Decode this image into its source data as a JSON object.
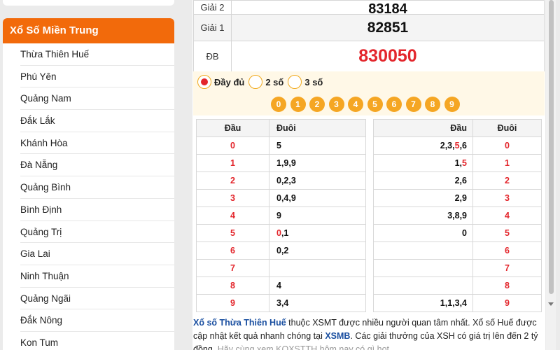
{
  "sidebar": {
    "title": "Xổ Số Miền Trung",
    "items": [
      {
        "label": "Thừa Thiên Huế"
      },
      {
        "label": "Phú Yên"
      },
      {
        "label": "Quảng Nam"
      },
      {
        "label": "Đắk Lắk"
      },
      {
        "label": "Khánh Hòa"
      },
      {
        "label": "Đà Nẵng"
      },
      {
        "label": "Quảng Bình"
      },
      {
        "label": "Bình Định"
      },
      {
        "label": "Quảng Trị"
      },
      {
        "label": "Gia Lai"
      },
      {
        "label": "Ninh Thuận"
      },
      {
        "label": "Quảng Ngãi"
      },
      {
        "label": "Đắk Nông"
      },
      {
        "label": "Kon Tum"
      }
    ]
  },
  "results": {
    "g2": {
      "label": "Giải 2",
      "value": "83184"
    },
    "g1": {
      "label": "Giải 1",
      "value": "82851"
    },
    "db": {
      "label": "ĐB",
      "value": "830050"
    }
  },
  "filters": {
    "options": [
      {
        "label": "Đầy đủ",
        "selected": true
      },
      {
        "label": "2 số",
        "selected": false
      },
      {
        "label": "3 số",
        "selected": false
      }
    ],
    "digits": [
      "0",
      "1",
      "2",
      "3",
      "4",
      "5",
      "6",
      "7",
      "8",
      "9"
    ]
  },
  "loto_left": {
    "header_dau": "Đầu",
    "header_duoi": "Đuôi",
    "rows": [
      {
        "dau": "0",
        "duoi": "5"
      },
      {
        "dau": "1",
        "duoi": "1,9,9"
      },
      {
        "dau": "2",
        "duoi": "0,2,3"
      },
      {
        "dau": "3",
        "duoi": "0,4,9"
      },
      {
        "dau": "4",
        "duoi": "9"
      },
      {
        "dau": "5",
        "duoi": "0,1"
      },
      {
        "dau": "6",
        "duoi": "0,2"
      },
      {
        "dau": "7",
        "duoi": ""
      },
      {
        "dau": "8",
        "duoi": "4"
      },
      {
        "dau": "9",
        "duoi": "3,4"
      }
    ]
  },
  "loto_right": {
    "header_dau": "Đầu",
    "header_duoi": "Đuôi",
    "rows": [
      {
        "dau": "2,3,5,6",
        "duoi": "0"
      },
      {
        "dau": "1,5",
        "duoi": "1"
      },
      {
        "dau": "2,6",
        "duoi": "2"
      },
      {
        "dau": "2,9",
        "duoi": "3"
      },
      {
        "dau": "3,8,9",
        "duoi": "4"
      },
      {
        "dau": "0",
        "duoi": "5"
      },
      {
        "dau": "",
        "duoi": "6"
      },
      {
        "dau": "",
        "duoi": "7"
      },
      {
        "dau": "",
        "duoi": "8"
      },
      {
        "dau": "1,1,3,4",
        "duoi": "9"
      }
    ]
  },
  "description": {
    "link1": "Xổ số Thừa Thiên Huế",
    "text1": " thuộc XSMT được nhiều người quan tâm nhất. Xổ số Huế được cập nhật kết quả nhanh chóng tại ",
    "link2": "XSMB",
    "text2": ". Các giải thưởng của XSH có giá trị lên đến 2 tỷ đồng.",
    "text3": "Hãy cùng xem KQXSTTH hôm nay có gì hot"
  },
  "colors": {
    "accent": "#f26a0b",
    "special": "#e3262c",
    "digit_ball": "#f5a623",
    "link": "#1a4fa0"
  }
}
